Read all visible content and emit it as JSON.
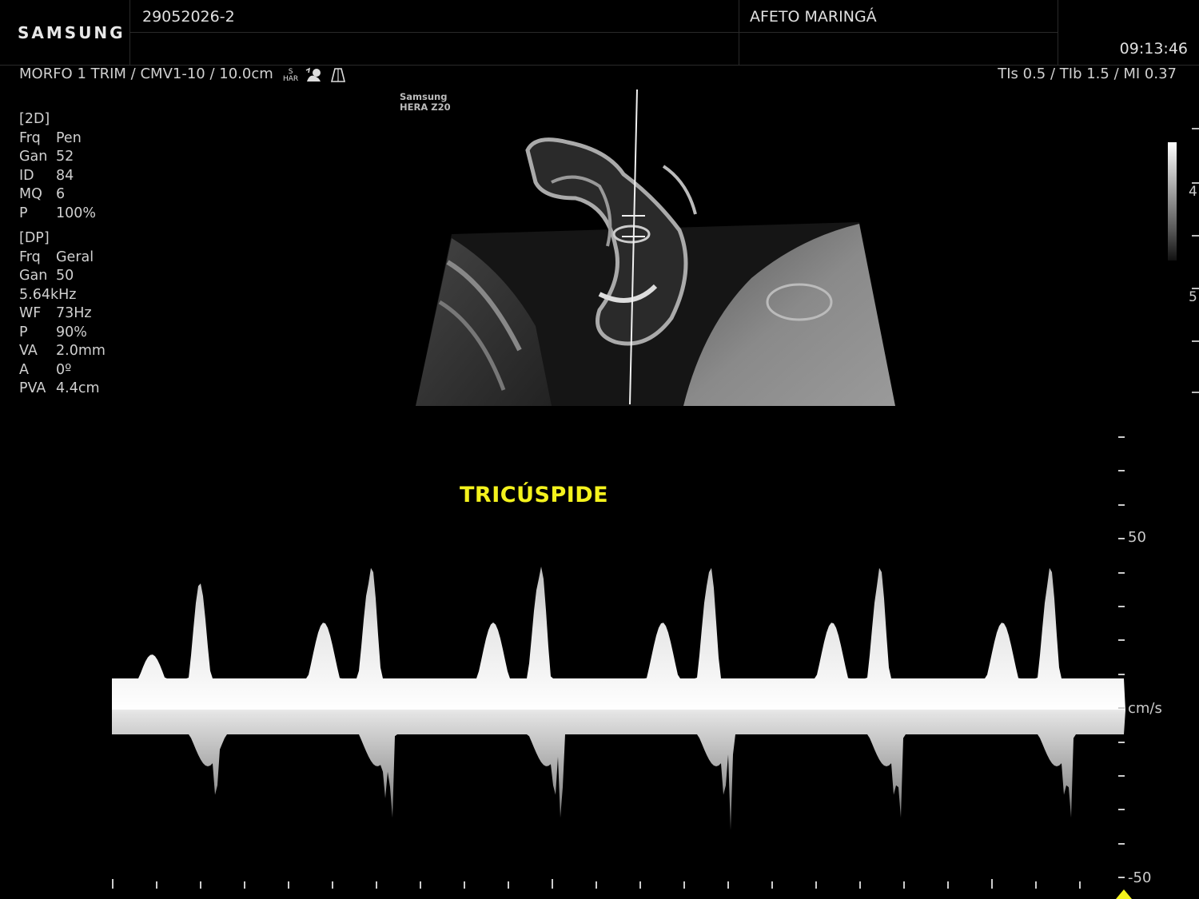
{
  "header": {
    "brand": "SAMSUNG",
    "patient_id": "29052026-2",
    "institution": "AFETO MARINGÁ",
    "time": "09:13:46"
  },
  "probe_line": "MORFO 1 TRIM / CMV1-10 / 10.0cm",
  "har_label_top": "S",
  "har_label_bottom": "HAR",
  "safety_indices": "TIs   0.5 / TIb   1.5 / MI   0.37",
  "system_label_line1": "Samsung",
  "system_label_line2": "HERA Z20",
  "params_2d": {
    "title": "[2D]",
    "rows": [
      {
        "k": "Frq",
        "v": "Pen"
      },
      {
        "k": "Gan",
        "v": "52"
      },
      {
        "k": "ID",
        "v": "84"
      },
      {
        "k": "MQ",
        "v": "6"
      },
      {
        "k": "P",
        "v": "100%"
      }
    ]
  },
  "params_dp": {
    "title": "[DP]",
    "rows": [
      {
        "k": "Frq",
        "v": "Geral"
      },
      {
        "k": "Gan",
        "v": "50"
      },
      {
        "k": "5.64kHz",
        "v": ""
      },
      {
        "k": "WF",
        "v": "73Hz"
      },
      {
        "k": "P",
        "v": "90%"
      },
      {
        "k": "VA",
        "v": "2.0mm"
      },
      {
        "k": "A",
        "v": "0º"
      },
      {
        "k": "PVA",
        "v": "4.4cm"
      }
    ]
  },
  "depth_labels": [
    "4",
    "5"
  ],
  "annotation": "TRICÚSPIDE",
  "velocity_scale": {
    "top_label": "50",
    "unit": "cm/s",
    "bottom_label": "-50"
  },
  "colors": {
    "annotation": "#f4f21d",
    "background": "#000000"
  }
}
